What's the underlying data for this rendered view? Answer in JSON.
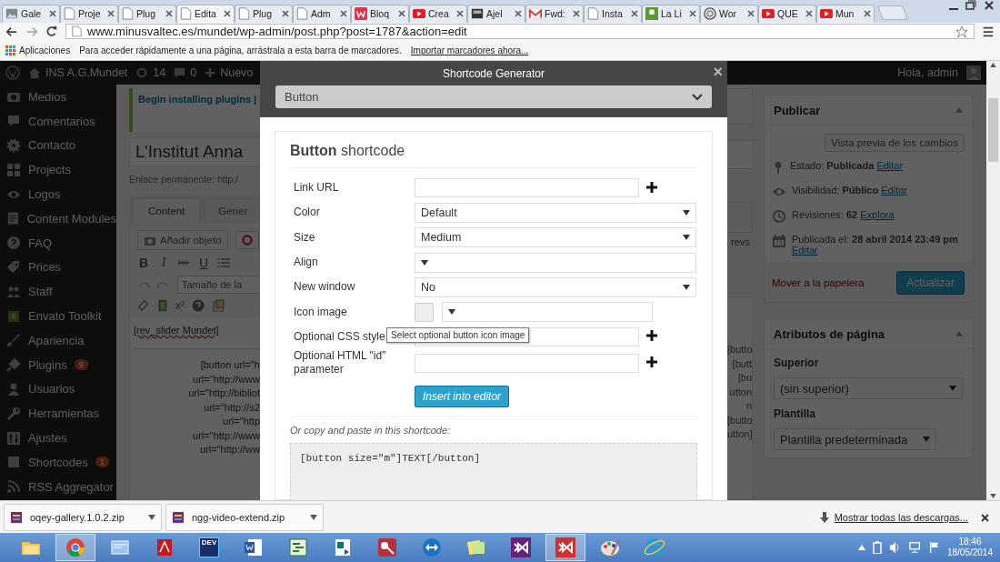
{
  "browser": {
    "tabs": [
      {
        "label": "Gale",
        "kind": "image",
        "selected": false
      },
      {
        "label": "Proje",
        "kind": "page",
        "selected": false
      },
      {
        "label": "Plug",
        "kind": "page",
        "selected": false
      },
      {
        "label": "Edita",
        "kind": "page",
        "selected": true
      },
      {
        "label": "Plug",
        "kind": "page",
        "selected": false
      },
      {
        "label": "Adm",
        "kind": "page",
        "selected": false
      },
      {
        "label": "Bloq",
        "kind": "brand",
        "selected": false
      },
      {
        "label": "Crea",
        "kind": "video",
        "selected": false
      },
      {
        "label": "Ajel",
        "kind": "badge",
        "selected": false
      },
      {
        "label": "Fwd:",
        "kind": "mail",
        "selected": false
      },
      {
        "label": "Insta",
        "kind": "page",
        "selected": false
      },
      {
        "label": "La Li",
        "kind": "green",
        "selected": false
      },
      {
        "label": "Wor",
        "kind": "globe",
        "selected": false
      },
      {
        "label": "QUE",
        "kind": "video",
        "selected": false
      },
      {
        "label": "Mun",
        "kind": "video",
        "selected": false
      }
    ],
    "url": "www.minusvaltec.es/mundet/wp-admin/post.php?post=1787&action=edit",
    "bookmarks": {
      "apps": "Aplicaciones",
      "hint": "Para acceder rápidamente a una página, arrástrala a esta barra de marcadores.",
      "import_link": "Importar marcadores ahora..."
    }
  },
  "admin_bar": {
    "site": "INS A.G.Mundet",
    "updates": "14",
    "comments": "0",
    "new": "Nuevo",
    "greeting": "Hola, admin"
  },
  "sidebar": {
    "items": [
      {
        "label": "Medios",
        "kind": "media"
      },
      {
        "label": "Comentarios",
        "kind": "comments"
      },
      {
        "label": "Contacto",
        "kind": "gear"
      },
      {
        "label": "Projects",
        "kind": "grid"
      },
      {
        "label": "Logos",
        "kind": "eye"
      },
      {
        "label": "Content Modules",
        "kind": "doc"
      },
      {
        "label": "FAQ",
        "kind": "help"
      },
      {
        "label": "Prices",
        "kind": "tag"
      },
      {
        "label": "Staff",
        "kind": "people"
      },
      {
        "label": "Envato Toolkit",
        "kind": "toolkit"
      },
      {
        "label": "Apariencia",
        "kind": "brush"
      },
      {
        "label": "Plugins",
        "kind": "plug",
        "badge": "9"
      },
      {
        "label": "Usuarios",
        "kind": "user"
      },
      {
        "label": "Herramientas",
        "kind": "wrench"
      },
      {
        "label": "Ajustes",
        "kind": "sliders"
      },
      {
        "label": "Shortcodes",
        "kind": "square",
        "badge": "1"
      },
      {
        "label": "RSS Aggregator",
        "kind": "rss"
      }
    ]
  },
  "editor": {
    "notice": "Begin installing plugins |",
    "title": "L’Institut Anna",
    "permalink": "Enlace permanente: http:/",
    "tabs": [
      {
        "label": "Content",
        "selected": true
      },
      {
        "label": "Gener",
        "selected": false
      }
    ],
    "add_media": "Añadir objeto",
    "format_buttons": [
      "B",
      "I",
      "U"
    ],
    "font_size": "Tamaño de la",
    "superscript": "x²",
    "first_line": "[rev_slider Mundet]",
    "lines": [
      "[button url=\"h",
      "url=\"http://www",
      "url=\"http://bibliot",
      "url=\"http://s2",
      "url=\"http",
      "url=\"http://www",
      "url=\"http://ww"
    ],
    "right_label": "revs",
    "right_lines": [
      "[butto",
      "[butt",
      "[bu",
      "utton",
      "n",
      "[butto",
      "utton]"
    ]
  },
  "modal": {
    "title": "Shortcode Generator",
    "close": "×",
    "type": "Button",
    "heading": "**Button** shortcode",
    "fields": [
      {
        "label": "Link URL",
        "kind": "text",
        "add": true
      },
      {
        "label": "Color",
        "kind": "select",
        "value": "Default",
        "add": false
      },
      {
        "label": "Size",
        "kind": "select",
        "value": "Medium",
        "add": false
      },
      {
        "label": "Align",
        "kind": "select",
        "add": false
      },
      {
        "label": "New window",
        "kind": "select",
        "value": "No",
        "add": false
      },
      {
        "label": "Icon image",
        "kind": "icon-select",
        "add": false
      },
      {
        "label": "Optional CSS style",
        "kind": "text",
        "add": true
      },
      {
        "label": "Optional HTML \"id\" parameter",
        "kind": "text",
        "add": true
      }
    ],
    "tooltip": "Select optional button icon image",
    "insert": "Insert into editor",
    "copy_label": "Or copy and paste in this shortcode:",
    "code": "[button size=\"m\"]TEXT[/button]"
  },
  "publish": {
    "title": "Publicar",
    "preview": "Vista previa de los cambios",
    "rows": [
      {
        "kind": "status",
        "text": "Estado: **Publicada**",
        "link": "Editar"
      },
      {
        "kind": "visibility",
        "text": "Visibilidad: **Público**",
        "link": "Editar"
      },
      {
        "kind": "revisions",
        "text": "Revisiones: **62**",
        "link": "Explora"
      },
      {
        "kind": "date",
        "text": "Publicada el: **28 abril 2014 23:49 pm**",
        "link": "Editar"
      }
    ],
    "trash": "Mover a la papelera",
    "update": "Actualizar"
  },
  "page_attributes": {
    "title": "Atributos de página",
    "parent_label": "Superior",
    "parent_value": "(sin superior)",
    "template_label": "Plantilla",
    "template_value": "Plantilla predeterminada"
  },
  "downloads": {
    "items": [
      {
        "name": "oqey-gallery.1.0.2.zip"
      },
      {
        "name": "ngg-video-extend.zip"
      }
    ],
    "show_all": "Mostrar todas las descargas..."
  },
  "taskbar": {
    "apps": [
      {
        "kind": "folder",
        "active": false
      },
      {
        "kind": "chrome",
        "active": true
      },
      {
        "kind": "window",
        "active": false
      },
      {
        "kind": "acrobat",
        "active": false
      },
      {
        "kind": "dev",
        "label": "DEV",
        "active": false
      },
      {
        "kind": "word",
        "active": false
      },
      {
        "kind": "project",
        "active": false
      },
      {
        "kind": "publisher",
        "active": false
      },
      {
        "kind": "access",
        "active": false
      },
      {
        "kind": "teamviewer",
        "active": false
      },
      {
        "kind": "notes",
        "active": false
      },
      {
        "kind": "vs",
        "active": false
      },
      {
        "kind": "vsred",
        "active": true
      },
      {
        "kind": "paint",
        "active": false
      },
      {
        "kind": "ie",
        "active": false
      }
    ],
    "time": "18:46",
    "date": "18/05/2014"
  }
}
